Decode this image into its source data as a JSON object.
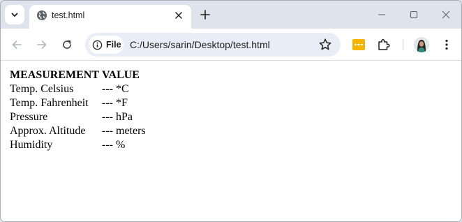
{
  "browser": {
    "tab": {
      "title": "test.html"
    },
    "address_bar": {
      "chip_label": "File",
      "url": "C:/Users/sarin/Desktop/test.html"
    }
  },
  "table": {
    "headers": [
      "MEASUREMENT",
      "VALUE"
    ],
    "rows": [
      {
        "measurement": "Temp. Celsius",
        "value": "--- *C"
      },
      {
        "measurement": "Temp. Fahrenheit",
        "value": "--- *F"
      },
      {
        "measurement": "Pressure",
        "value": "--- hPa"
      },
      {
        "measurement": "Approx. Altitude",
        "value": "--- meters"
      },
      {
        "measurement": "Humidity",
        "value": "--- %"
      }
    ]
  },
  "icons": {
    "tab_search": "chevron-down-icon",
    "favicon": "globe-icon",
    "tab_close": "close-icon",
    "new_tab": "plus-icon",
    "minimize": "minimize-icon",
    "maximize": "maximize-icon",
    "close": "close-window-icon",
    "back": "back-arrow-icon",
    "forward": "forward-arrow-icon",
    "reload": "reload-icon",
    "site_info": "info-icon",
    "bookmark": "star-icon",
    "extension_1": "yellow-extension-icon",
    "extensions": "puzzle-icon",
    "profile": "avatar",
    "menu": "kebab-menu-icon"
  },
  "colors": {
    "tab_strip": "#dfe3eb",
    "omnibox": "#e9eef6",
    "extension_yellow": "#f4b400"
  }
}
